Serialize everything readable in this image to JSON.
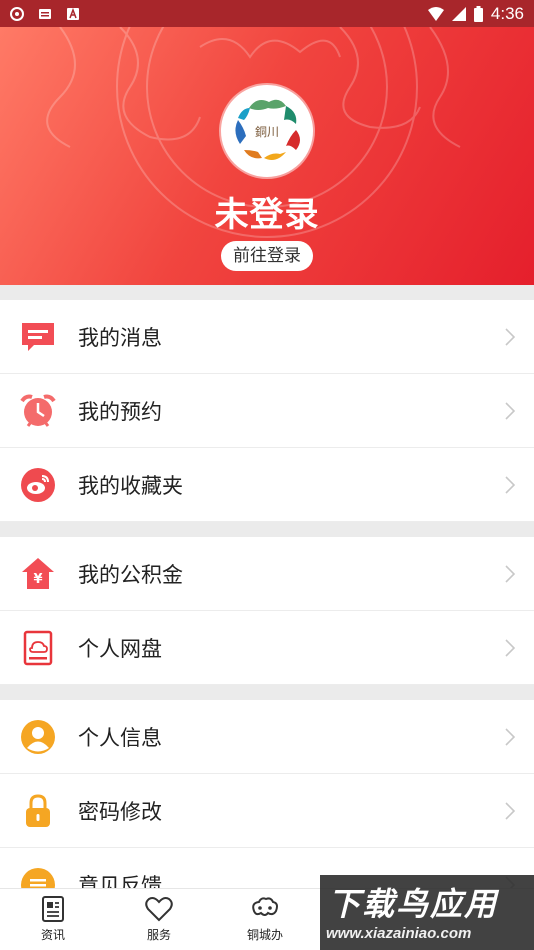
{
  "status_bar": {
    "time": "4:36"
  },
  "header": {
    "title": "未登录",
    "login_label": "前往登录",
    "logo_text": "銅川"
  },
  "menu_groups": [
    [
      {
        "label": "我的消息",
        "icon": "message-icon"
      },
      {
        "label": "我的预约",
        "icon": "alarm-clock-icon"
      },
      {
        "label": "我的收藏夹",
        "icon": "weibo-icon"
      }
    ],
    [
      {
        "label": "我的公积金",
        "icon": "house-yuan-icon"
      },
      {
        "label": "个人网盘",
        "icon": "cloud-drive-icon"
      }
    ],
    [
      {
        "label": "个人信息",
        "icon": "user-icon"
      },
      {
        "label": "密码修改",
        "icon": "lock-icon"
      },
      {
        "label": "意见反馈",
        "icon": "feedback-icon"
      }
    ]
  ],
  "bottom_nav": [
    {
      "label": "资讯",
      "icon": "news-icon"
    },
    {
      "label": "服务",
      "icon": "heart-icon"
    },
    {
      "label": "铜城办",
      "icon": "cloud-ornament-icon"
    }
  ],
  "watermark": {
    "title": "下载鸟应用",
    "url": "www.xiazainiao.com"
  },
  "colors": {
    "accent": "#e8353b",
    "header_start": "#ff7a66",
    "header_end": "#e51f2c"
  }
}
